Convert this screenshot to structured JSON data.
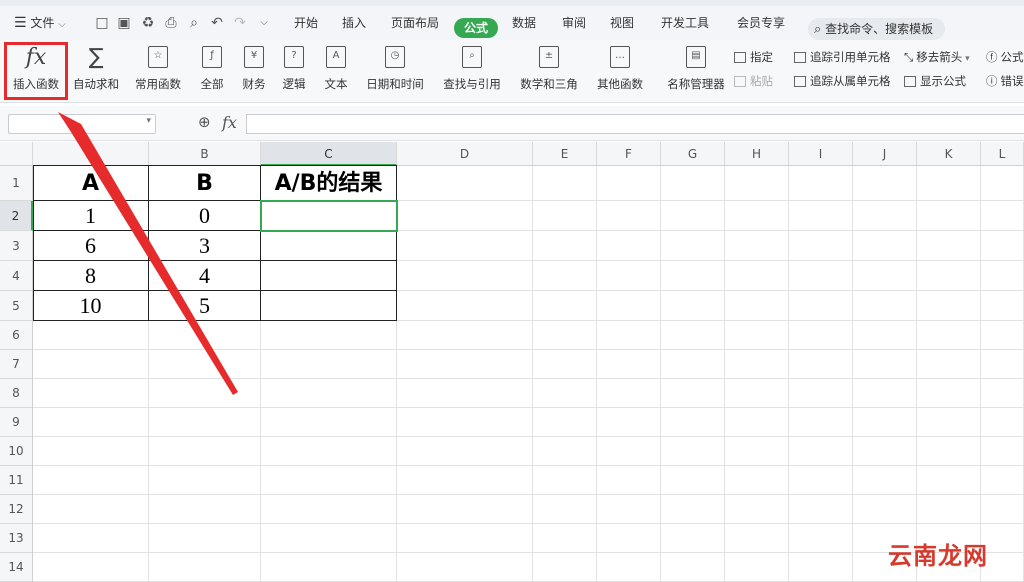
{
  "menubar": {
    "file_label": "文件",
    "tabs": [
      {
        "label": "开始"
      },
      {
        "label": "插入"
      },
      {
        "label": "页面布局"
      },
      {
        "label": "公式",
        "active": true
      },
      {
        "label": "数据"
      },
      {
        "label": "审阅"
      },
      {
        "label": "视图"
      },
      {
        "label": "开发工具"
      },
      {
        "label": "会员专享"
      }
    ],
    "search_placeholder": "查找命令、搜索模板",
    "accent_color": "#35a852"
  },
  "ribbon": {
    "insert_function": {
      "icon_text": "fx",
      "label": "插入函数"
    },
    "autosum": {
      "label": "自动求和"
    },
    "common": {
      "label": "常用函数"
    },
    "all": {
      "label": "全部"
    },
    "finance": {
      "label": "财务"
    },
    "logic": {
      "label": "逻辑"
    },
    "text": {
      "label": "文本"
    },
    "datetime": {
      "label": "日期和时间"
    },
    "lookup": {
      "label": "查找与引用"
    },
    "math": {
      "label": "数学和三角"
    },
    "other": {
      "label": "其他函数"
    },
    "name_manager": {
      "label": "名称管理器"
    },
    "specify": {
      "label": "指定"
    },
    "paste": {
      "label": "粘贴"
    },
    "trace_precedents": {
      "label": "追踪引用单元格"
    },
    "trace_dependents": {
      "label": "追踪从属单元格"
    },
    "remove_arrows": {
      "label": "移去箭头"
    },
    "show_formulas": {
      "label": "显示公式"
    },
    "formula_cut": {
      "label": "公式"
    },
    "error_cut": {
      "label": "错误"
    },
    "highlight_color": "#e52b2b"
  },
  "formula_bar": {
    "fx_label": "fx",
    "value": ""
  },
  "sheet": {
    "columns": [
      "A",
      "B",
      "C",
      "D",
      "E",
      "F",
      "G",
      "H",
      "I",
      "J",
      "K",
      "L"
    ],
    "rows": [
      "1",
      "2",
      "3",
      "4",
      "5",
      "6",
      "7",
      "8",
      "9",
      "10",
      "11",
      "12",
      "13",
      "14"
    ],
    "selected_cell": "C2",
    "headers": [
      "A",
      "B",
      "A/B的结果"
    ],
    "data": [
      [
        "1",
        "0",
        ""
      ],
      [
        "6",
        "3",
        ""
      ],
      [
        "8",
        "4",
        ""
      ],
      [
        "10",
        "5",
        ""
      ]
    ]
  },
  "watermark": "云南龙网"
}
